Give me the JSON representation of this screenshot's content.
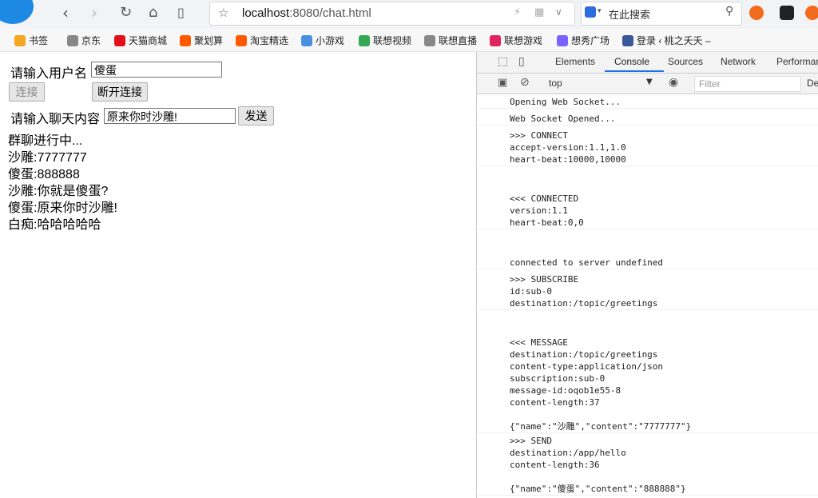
{
  "browser": {
    "url_host": "localhost",
    "url_rest": ":8080/chat.html",
    "search_placeholder": "在此搜索",
    "bookmarks": [
      {
        "label": "书签",
        "color": "#f5a623"
      },
      {
        "label": "京东",
        "color": "#888888"
      },
      {
        "label": "天猫商城",
        "color": "#e3101c"
      },
      {
        "label": "聚划算",
        "color": "#ff5a00"
      },
      {
        "label": "淘宝精选",
        "color": "#ff5a00"
      },
      {
        "label": "小游戏",
        "color": "#4a90e2"
      },
      {
        "label": "联想视频",
        "color": "#34a853"
      },
      {
        "label": "联想直播",
        "color": "#888888"
      },
      {
        "label": "联想游戏",
        "color": "#e0245e"
      },
      {
        "label": "想秀广场",
        "color": "#7b61ff"
      },
      {
        "label": "登录 ‹ 桃之夭夭 –",
        "color": "#3b5998"
      }
    ]
  },
  "page": {
    "username_label": "请输入用户名",
    "username_value": "傻蛋",
    "connect_label": "连接",
    "disconnect_label": "断开连接",
    "chat_label": "请输入聊天内容",
    "chat_value": "原来你时沙雕!",
    "send_label": "发送",
    "messages": [
      "群聊进行中...",
      "沙雕:7777777",
      "傻蛋:888888",
      "沙雕:你就是傻蛋?",
      "傻蛋:原来你时沙雕!",
      "白痴:哈哈哈哈哈"
    ]
  },
  "devtools": {
    "tabs": [
      "Elements",
      "Console",
      "Sources",
      "Network",
      "Performan"
    ],
    "active_tab": "Console",
    "context": "top",
    "filter_placeholder": "Filter",
    "level_cut": "De",
    "entries": [
      "Opening Web Socket...",
      "Web Socket Opened...",
      ">>> CONNECT\naccept-version:1.1,1.0\nheart-beat:10000,10000",
      "<<< CONNECTED\nversion:1.1\nheart-beat:0,0",
      "connected to server undefined",
      ">>> SUBSCRIBE\nid:sub-0\ndestination:/topic/greetings",
      "<<< MESSAGE\ndestination:/topic/greetings\ncontent-type:application/json\nsubscription:sub-0\nmessage-id:oqob1e55-8\ncontent-length:37\n\n{\"name\":\"沙雕\",\"content\":\"7777777\"}",
      ">>> SEND\ndestination:/app/hello\ncontent-length:36\n\n{\"name\":\"傻蛋\",\"content\":\"888888\"}"
    ]
  }
}
